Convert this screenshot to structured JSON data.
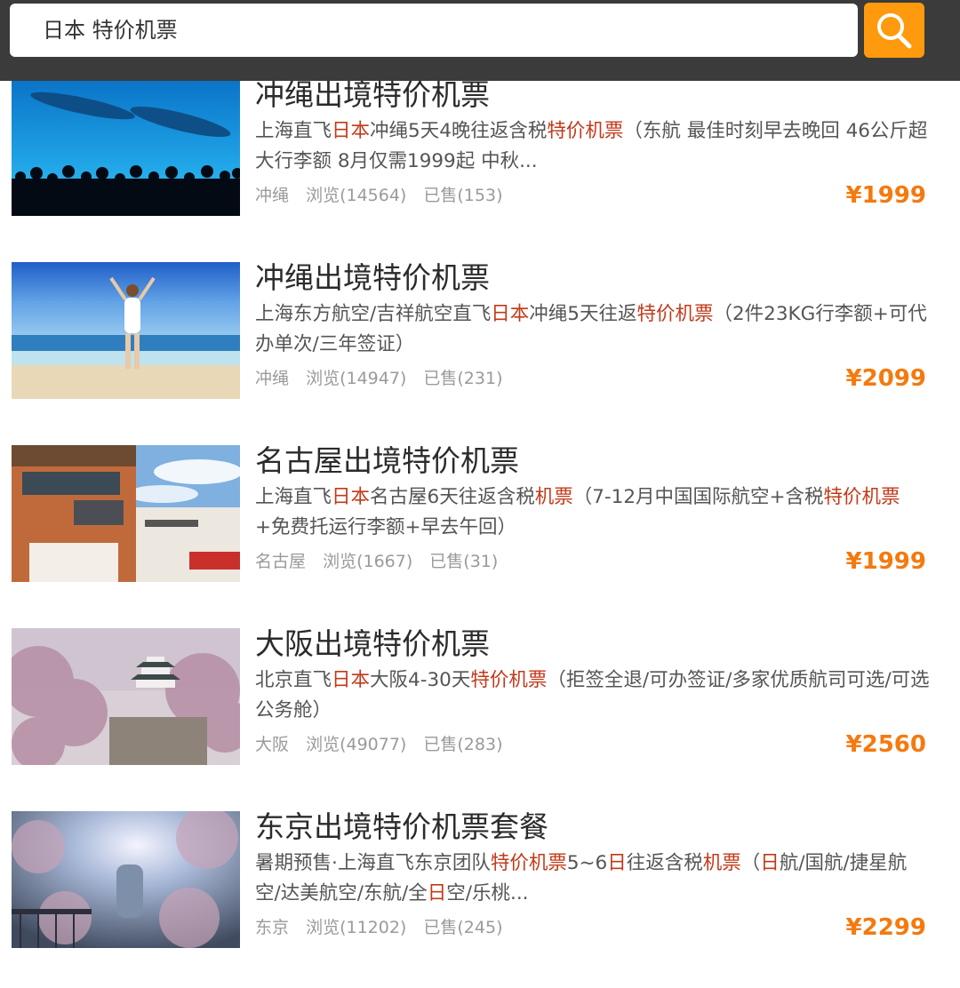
{
  "search": {
    "query": "日本 特价机票"
  },
  "items": [
    {
      "title": "冲绳出境特价机票",
      "desc": [
        {
          "t": "上海直飞",
          "h": false
        },
        {
          "t": "日本",
          "h": true
        },
        {
          "t": "冲绳5天4晚往返含税",
          "h": false
        },
        {
          "t": "特价机票",
          "h": true
        },
        {
          "t": "（东航 最佳时刻早去晚回 46公斤超大行李额 8月仅需1999起 中秋...",
          "h": false
        }
      ],
      "location": "冲绳",
      "views": "浏览(14564)",
      "sold": "已售(153)",
      "price": "¥1999"
    },
    {
      "title": "冲绳出境特价机票",
      "desc": [
        {
          "t": "上海东方航空/吉祥航空直飞",
          "h": false
        },
        {
          "t": "日本",
          "h": true
        },
        {
          "t": "冲绳5天往返",
          "h": false
        },
        {
          "t": "特价机票",
          "h": true
        },
        {
          "t": "（2件23KG行李额+可代办单次/三年签证）",
          "h": false
        }
      ],
      "location": "冲绳",
      "views": "浏览(14947)",
      "sold": "已售(231)",
      "price": "¥2099"
    },
    {
      "title": "名古屋出境特价机票",
      "desc": [
        {
          "t": "上海直飞",
          "h": false
        },
        {
          "t": "日本",
          "h": true
        },
        {
          "t": "名古屋6天往返含税",
          "h": false
        },
        {
          "t": "机票",
          "h": true
        },
        {
          "t": "（7-12月中国国际航空+含税",
          "h": false
        },
        {
          "t": "特价机票",
          "h": true
        },
        {
          "t": "+免费托运行李额+早去午回）",
          "h": false
        }
      ],
      "location": "名古屋",
      "views": "浏览(1667)",
      "sold": "已售(31)",
      "price": "¥1999"
    },
    {
      "title": "大阪出境特价机票",
      "desc": [
        {
          "t": "北京直飞",
          "h": false
        },
        {
          "t": "日本",
          "h": true
        },
        {
          "t": "大阪4-30天",
          "h": false
        },
        {
          "t": "特价机票",
          "h": true
        },
        {
          "t": "（拒签全退/可办签证/多家优质航司可选/可选公务舱）",
          "h": false
        }
      ],
      "location": "大阪",
      "views": "浏览(49077)",
      "sold": "已售(283)",
      "price": "¥2560"
    },
    {
      "title": "东京出境特价机票套餐",
      "desc": [
        {
          "t": "暑期预售·上海直飞东京团队",
          "h": false
        },
        {
          "t": "特价机票",
          "h": true
        },
        {
          "t": "5~6",
          "h": false
        },
        {
          "t": "日",
          "h": true
        },
        {
          "t": "往返含税",
          "h": false
        },
        {
          "t": "机票",
          "h": true
        },
        {
          "t": "（",
          "h": false
        },
        {
          "t": "日",
          "h": true
        },
        {
          "t": "航/国航/捷星航空/达美航空/东航/全",
          "h": false
        },
        {
          "t": "日",
          "h": true
        },
        {
          "t": "空/乐桃...",
          "h": false
        }
      ],
      "location": "东京",
      "views": "浏览(11202)",
      "sold": "已售(245)",
      "price": "¥2299"
    }
  ],
  "colors": {
    "accent": "#ff9a0e",
    "price": "#f47a0f",
    "highlight": "#c23a1a",
    "header": "#3b3b3b"
  },
  "icons": {
    "search": "search-icon"
  }
}
